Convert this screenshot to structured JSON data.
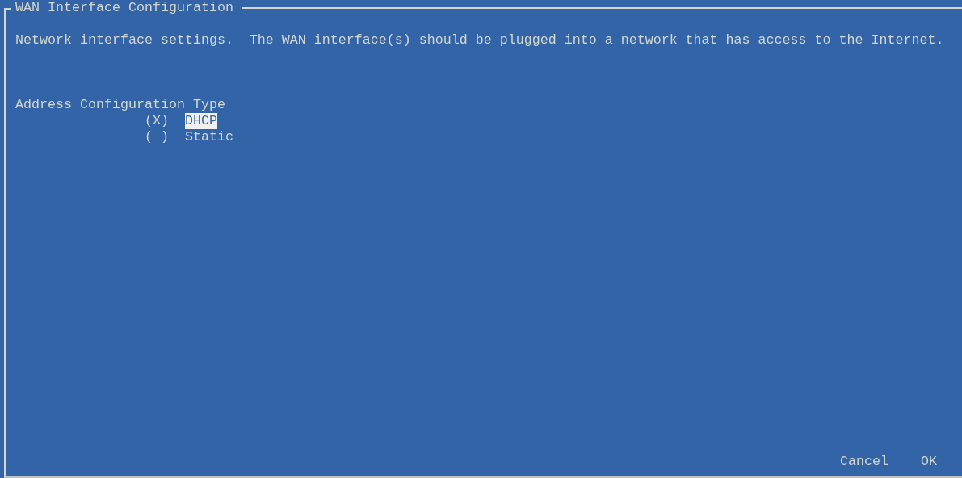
{
  "dialog": {
    "title": "WAN Interface Configuration",
    "description": "Network interface settings.  The WAN interface(s) should be plugged into a network that has access to the Internet."
  },
  "field": {
    "label": "Address Configuration Type",
    "radio_open": "(",
    "radio_close": ")",
    "radio_mark": "X",
    "options": [
      {
        "checked": true,
        "label": "DHCP",
        "focused": true
      },
      {
        "checked": false,
        "label": "Static",
        "focused": false
      }
    ]
  },
  "buttons": [
    {
      "label": "Cancel",
      "focused": false
    },
    {
      "label": "OK",
      "focused": false
    }
  ]
}
